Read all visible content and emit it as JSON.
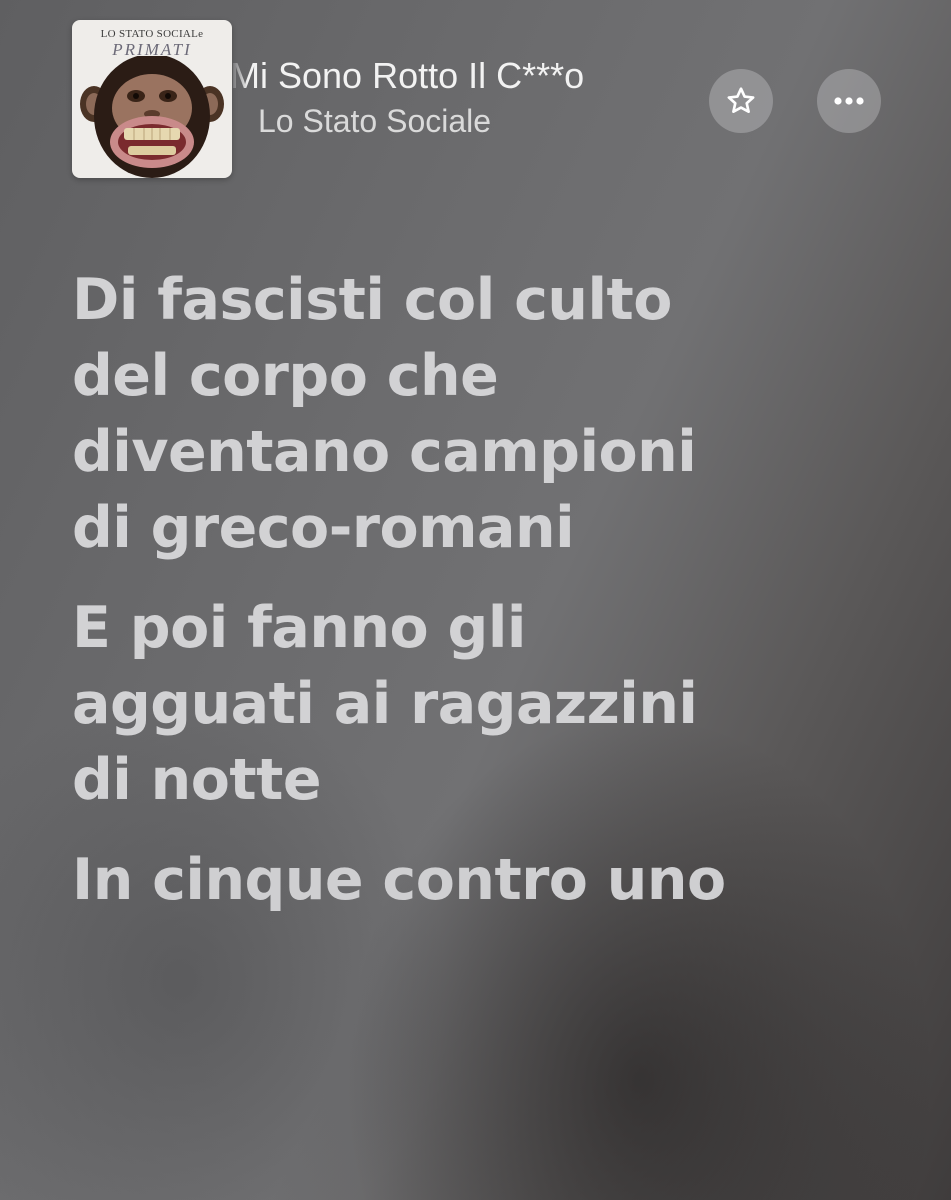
{
  "now_playing": {
    "artwork": {
      "brand_top": "LO STATO SOCIALe",
      "brand_bottom": "PRIMATI"
    },
    "song_title": "Mi Sono Rotto Il C***o",
    "artist": "Lo Stato Sociale"
  },
  "actions": {
    "favorite_icon": "star-icon",
    "more_icon": "ellipsis-icon"
  },
  "lyrics": {
    "stanzas": [
      {
        "lines": [
          "Di fascisti col culto",
          "del corpo che",
          "diventano campioni",
          "di greco-romani"
        ]
      },
      {
        "lines": [
          "E poi fanno gli",
          "agguati ai ragazzini",
          "di notte"
        ]
      },
      {
        "lines": [
          "In cinque contro uno"
        ]
      }
    ]
  }
}
